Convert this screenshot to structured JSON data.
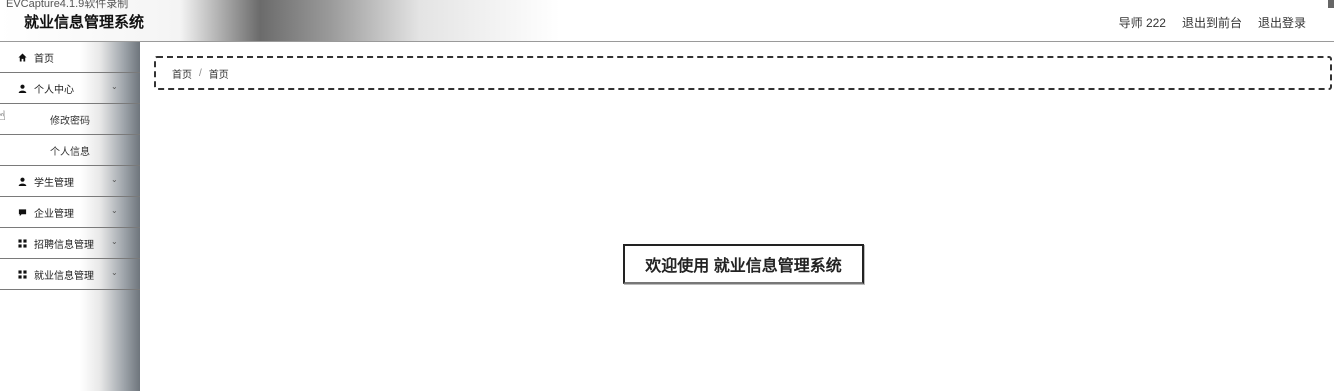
{
  "capture_caption": "EVCapture4.1.9软件录制",
  "app_title": "就业信息管理系统",
  "top_links": {
    "user": "导师 222",
    "to_frontend": "退出到前台",
    "logout": "退出登录"
  },
  "sidebar": {
    "home": "首页",
    "personal_center": "个人中心",
    "personal_sub": [
      "修改密码",
      "个人信息"
    ],
    "student_mgmt": "学生管理",
    "company_mgmt": "企业管理",
    "recruit_mgmt": "招聘信息管理",
    "employment_mgmt": "就业信息管理"
  },
  "breadcrumb": [
    "首页",
    "首页"
  ],
  "welcome_text": "欢迎使用 就业信息管理系统"
}
